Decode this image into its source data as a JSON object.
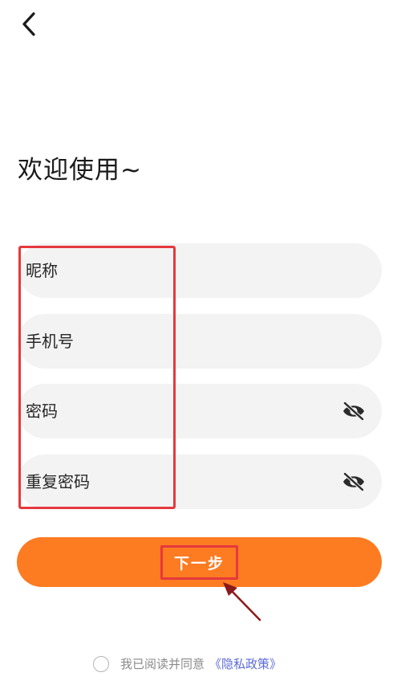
{
  "header": {
    "back_icon": "chevron-left-icon"
  },
  "title": "欢迎使用~",
  "form": {
    "nickname_placeholder": "昵称",
    "phone_placeholder": "手机号",
    "password_placeholder": "密码",
    "confirm_password_placeholder": "重复密码",
    "visibility_icon": "eye-off-icon"
  },
  "next_button": {
    "label": "下一步",
    "color": "#fd7b21"
  },
  "agreement": {
    "text": "我已阅读并同意",
    "policy_link": "《隐私政策》",
    "checked": false
  },
  "annotation_color": "#e5393e"
}
